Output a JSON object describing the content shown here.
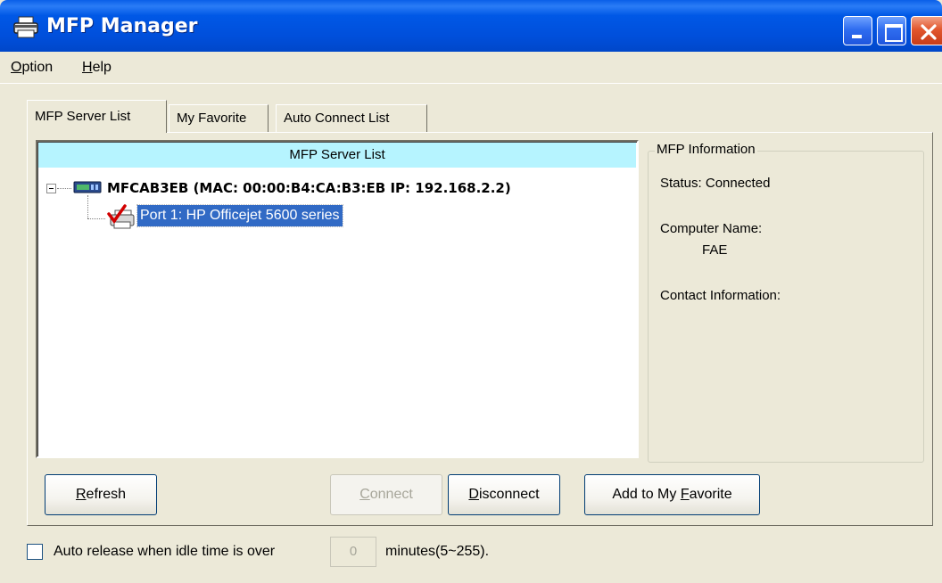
{
  "window": {
    "title": "MFP Manager",
    "icon": "printer-icon"
  },
  "menu": {
    "option": {
      "hotkey": "O",
      "rest": "ption"
    },
    "help": {
      "hotkey": "H",
      "rest": "elp"
    }
  },
  "tabs": [
    {
      "label": "MFP Server List",
      "active": true
    },
    {
      "label": "My Favorite",
      "active": false
    },
    {
      "label": "Auto Connect List",
      "active": false
    }
  ],
  "server_list": {
    "header": "MFP Server List",
    "server": {
      "label": "MFCAB3EB (MAC: 00:00:B4:CA:B3:EB   IP: 192.168.2.2)",
      "expanded": true,
      "icon": "server-device-icon"
    },
    "port": {
      "label": "Port 1: HP Officejet 5600 series",
      "selected": true,
      "icon": "printer-connected-icon"
    }
  },
  "info": {
    "legend": "MFP Information",
    "status": "Status: Connected",
    "computer_name_label": "Computer Name:",
    "computer_name_value": "FAE",
    "contact_label": "Contact Information:"
  },
  "buttons": {
    "refresh": {
      "hotkey": "R",
      "rest": "efresh"
    },
    "connect": {
      "hotkey": "C",
      "rest": "onnect",
      "disabled": true
    },
    "disconnect": {
      "hotkey": "D",
      "rest": "isconnect"
    },
    "add_favorite": {
      "prefix": "Add to My ",
      "hotkey": "F",
      "rest": "avorite"
    }
  },
  "auto_release": {
    "checked": false,
    "label": "Auto release when idle time is over",
    "value": "0",
    "suffix": "minutes(5~255)."
  },
  "colors": {
    "titlebar": "#0054e3",
    "header_bg": "#b6f4ff",
    "selection": "#316ac5",
    "face": "#ece9d8"
  }
}
